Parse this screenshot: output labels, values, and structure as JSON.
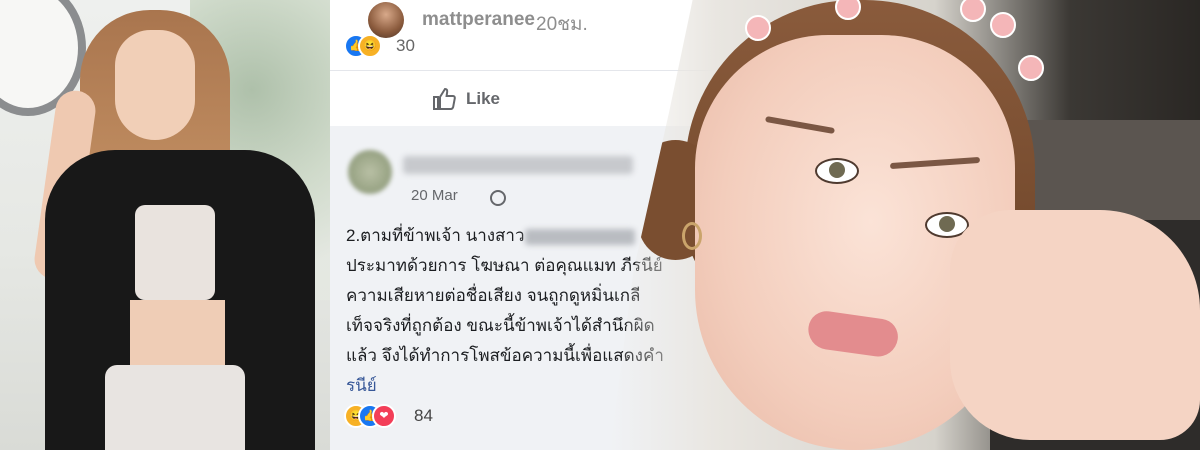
{
  "colors": {
    "facebook_blue": "#1877f2",
    "link_color": "#385898",
    "secondary_text": "#65676b",
    "comment_bg": "#f0f2f5"
  },
  "post_header": {
    "username": "mattperanee",
    "time": "20ชม.",
    "reaction_count": "30",
    "reaction_icons": [
      "like-icon",
      "haha-icon"
    ]
  },
  "action_bar": {
    "like_label": "Like",
    "like_icon": "thumbs-up-icon"
  },
  "comment": {
    "date": "20 Mar",
    "privacy_icon": "globe-icon",
    "lines": [
      "2.ตามที่ข้าพเจ้า นางสาว",
      "ประมาทด้วยการ โฆษณา ต่อคุณแมท ภีรนีย์",
      "ความเสียหายต่อชื่อเสียง จนถูกดูหมิ่นเกลี",
      "เท็จจริงที่ถูกต้อง ขณะนี้ข้าพเจ้าได้สำนึกผิด",
      "แล้ว จึงได้ทำการโพสข้อความนี้เพื่อแสดงคำ"
    ],
    "more_text": "รนีย์",
    "reaction_count": "84",
    "reaction_icons": [
      "haha-icon",
      "like-icon",
      "love-icon"
    ]
  }
}
